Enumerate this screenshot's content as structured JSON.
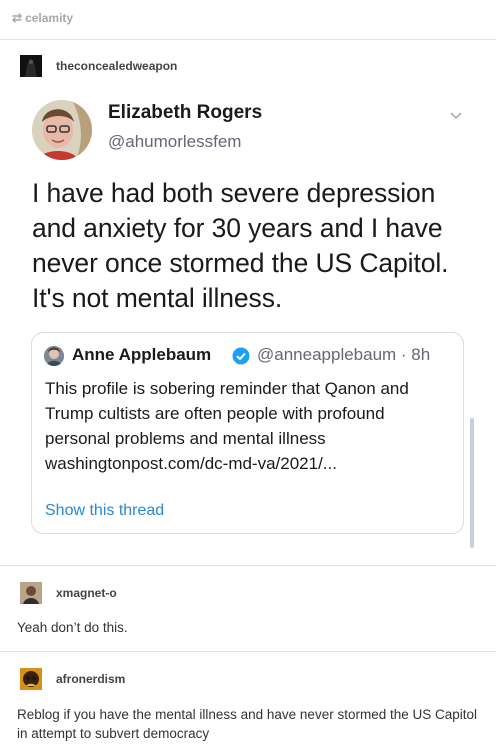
{
  "reblog": {
    "icon": "reblog-icon",
    "username": "celamity"
  },
  "posts": [
    {
      "username": "theconcealedweapon",
      "avatar": "dark-figure-avatar"
    },
    {
      "username": "xmagnet-o",
      "comment": "Yeah don’t do this."
    },
    {
      "username": "afronerdism",
      "comment": "Reblog if you have the mental illness and have never stormed the US Capitol in attempt to subvert democracy"
    }
  ],
  "tweet": {
    "name": "Elizabeth Rogers",
    "handle": "@ahumorlessfem",
    "text": "I have had both severe depression and anxiety for 30 years and I have never once stormed the US Capitol. It's not mental illness.",
    "quote": {
      "name": "Anne Applebaum",
      "handle": "@anneapplebaum · 8h",
      "text": "This profile is sobering reminder that Qanon and Trump cultists are often people with profound personal problems and mental illness",
      "url": "washingtonpost.com/dc-md-va/2021/...",
      "link_label": "Show this thread"
    }
  },
  "colors": {
    "link": "#2a87d0",
    "verified": "#1da1f2",
    "muted": "#a8a8a8"
  }
}
